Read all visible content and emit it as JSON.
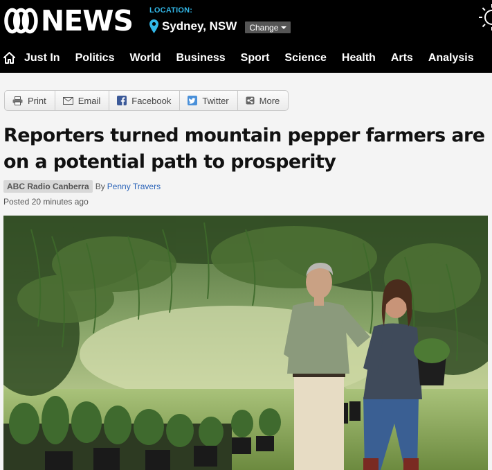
{
  "brand": {
    "logo_text": "NEWS"
  },
  "location": {
    "label": "LOCATION:",
    "city": "Sydney, NSW",
    "change_label": "Change"
  },
  "nav": {
    "items": [
      {
        "label": "Just In"
      },
      {
        "label": "Politics"
      },
      {
        "label": "World"
      },
      {
        "label": "Business"
      },
      {
        "label": "Sport"
      },
      {
        "label": "Science"
      },
      {
        "label": "Health"
      },
      {
        "label": "Arts"
      },
      {
        "label": "Analysis"
      }
    ]
  },
  "share": {
    "buttons": [
      {
        "label": "Print",
        "icon": "printer-icon"
      },
      {
        "label": "Email",
        "icon": "envelope-icon"
      },
      {
        "label": "Facebook",
        "icon": "facebook-icon"
      },
      {
        "label": "Twitter",
        "icon": "twitter-icon"
      },
      {
        "label": "More",
        "icon": "share-more-icon"
      }
    ]
  },
  "article": {
    "headline": "Reporters turned mountain pepper farmers are on a potential path to prosperity",
    "source": "ABC Radio Canberra",
    "by": "By",
    "author": "Penny Travers",
    "posted": "Posted 20 minutes ago"
  },
  "colors": {
    "masthead": "#000000",
    "location_label": "#32b8e8",
    "author_link": "#2a63b8",
    "facebook": "#3b5998",
    "twitter": "#4a90d9"
  }
}
